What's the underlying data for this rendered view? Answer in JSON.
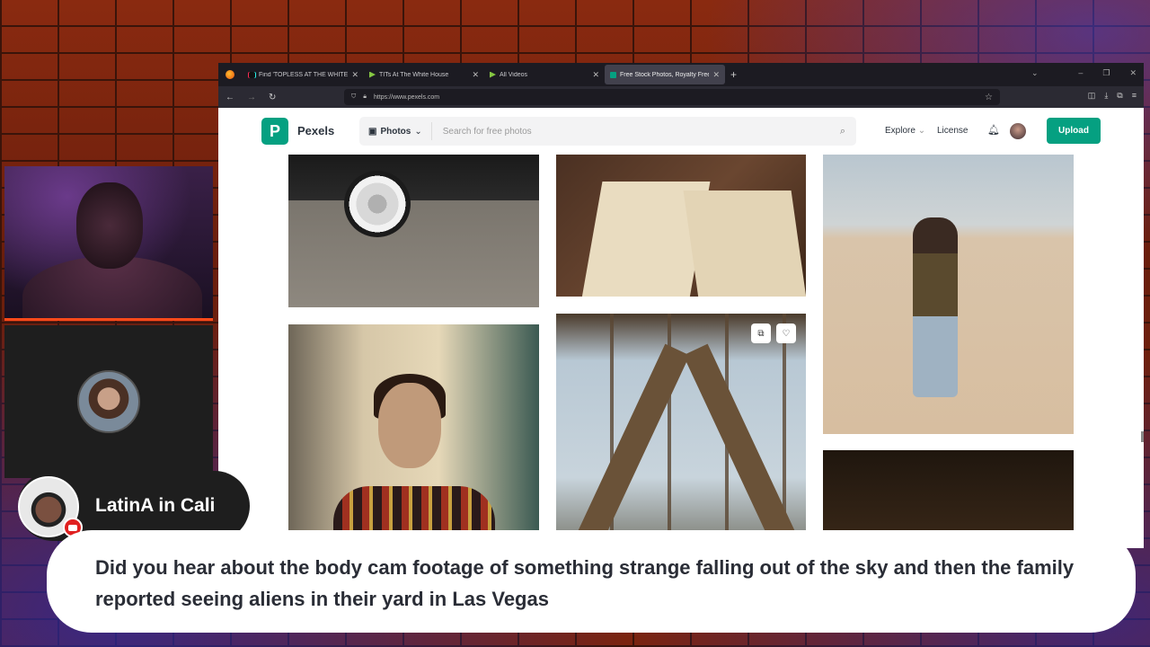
{
  "browser": {
    "tabs": [
      {
        "label": "Find 'TOPLESS AT THE WHITE H",
        "icon": "tiktok-icon",
        "active": false
      },
      {
        "label": "TITs At The White House",
        "icon": "rumble-icon",
        "active": false
      },
      {
        "label": "All Videos",
        "icon": "rumble-icon",
        "active": false
      },
      {
        "label": "Free Stock Photos, Royalty Free",
        "icon": "pexels-icon",
        "active": true
      }
    ],
    "url": "https://www.pexels.com"
  },
  "pexels": {
    "brand": "Pexels",
    "logo_letter": "P",
    "search_kind": "Photos",
    "search_placeholder": "Search for free photos",
    "nav_explore": "Explore",
    "nav_license": "License",
    "upload": "Upload",
    "accent_color": "#05a081"
  },
  "stream": {
    "guest_name": "LatinA in Cali",
    "caption": "Did you hear about the body cam footage of something strange falling out of the sky and then the family reported seeing aliens in their yard in Las Vegas"
  }
}
